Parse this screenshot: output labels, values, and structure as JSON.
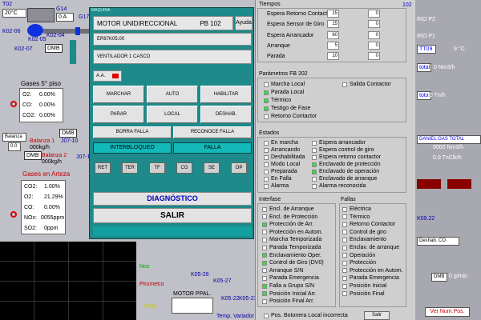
{
  "background": {
    "t02": "T02",
    "t02_val": "20°C",
    "g14": "G14",
    "g14_val": "0 A",
    "k02_06": "K02-06",
    "k02_05": "K02-05",
    "k02_04": "K02-04",
    "k02_07": "K02-07",
    "g17": "G17",
    "dmb": "DMB",
    "gases5": "Gases 5° piso",
    "o2_label": "O2:",
    "o2_val": "0.00%",
    "co_label": "CO:",
    "co_val": "0.00%",
    "co2_label": "CO2:",
    "co2_val": "0.00%",
    "balanza1": "Balanza 1",
    "balanza1_val": "000kg/h",
    "balanza2": "Balanza 2",
    "balanza2_val": "000kg/h",
    "balanza_label": "Balanza",
    "balanza_num": "0.0",
    "j07_10": "J07-10",
    "j07_11": "J07-11",
    "gases_arteza": "Gases en Arteza",
    "co2b_label": "CO2:",
    "co2b_val": "1.00%",
    "o2b_label": "O2:",
    "o2b_val": "21.29%",
    "cob_label": "CO:",
    "cob_val": "0.00%",
    "nox_label": "NOx:",
    "nox_val": "0055ppm",
    "so2_label": "SO2:",
    "so2_val": "0ppm",
    "nos": "Nos",
    "pirometro": "Pirometro",
    "rpm": "RPM",
    "k05_26": "K05-26",
    "k05_27": "K05-27",
    "k05_22": "K05-22",
    "k05_23": "K05-23",
    "motor": "MOTOR PPAL.",
    "temp_variador": "Temp. Variador"
  },
  "popup": {
    "window_title": "MAQUINA",
    "title": "MOTOR UNIDIRECCIONAL",
    "code": "PB 102",
    "help": "Ayuda",
    "field1": "ER67K05.00",
    "field2": "VENTILADOR 1 CASCO",
    "aa": "A.A.",
    "marchar": "MARCHAR",
    "auto": "AUTO",
    "habilitar": "HABILITAR",
    "parar": "PARAR",
    "local": "LOCAL",
    "deshab": "DESHAB.",
    "borra_falla": "BORRA FALLA",
    "reconoce_falla": "RECONOCE FALLA",
    "interbloqueo": "INTERBLOQUEO",
    "falla": "FALLA",
    "small_buttons": [
      "RET",
      "TER",
      "TF",
      "CG",
      "SE",
      "OP"
    ],
    "diagnostico": "DIAGNÓSTICO",
    "salir": "SALIR"
  },
  "right": {
    "tiempos": "Tiempos",
    "tiempo_rows": [
      {
        "label": "Espera Retorno Contactor",
        "v1": "15",
        "v2": "0"
      },
      {
        "label": "Espera Sensor de Giro",
        "v1": "15",
        "v2": "0"
      },
      {
        "label": "Espera Arrancador",
        "v1": "60",
        "v2": "0"
      },
      {
        "label": "Arranque",
        "v1": "5",
        "v2": "0"
      },
      {
        "label": "Parada",
        "v1": "10",
        "v2": "0"
      }
    ],
    "badge": "102",
    "parametros": "Parámetros FB 202",
    "param_left": [
      {
        "label": "Marcha Local",
        "on": false
      },
      {
        "label": "Parada Local",
        "on": true
      },
      {
        "label": "Térmico",
        "on": true
      },
      {
        "label": "Testigo de Fase",
        "on": true
      },
      {
        "label": "Retorno Contactor",
        "on": false
      }
    ],
    "param_right": [
      {
        "label": "Salida Contactor",
        "on": false
      }
    ],
    "estados": "Estados",
    "estados_left": [
      {
        "label": "En marcha",
        "on": false
      },
      {
        "label": "Arrancando",
        "on": false
      },
      {
        "label": "Deshabilitada",
        "on": false
      },
      {
        "label": "Modo Local",
        "on": false
      },
      {
        "label": "Preparada",
        "on": false
      },
      {
        "label": "En Falla",
        "on": false
      },
      {
        "label": "Alarma",
        "on": false
      }
    ],
    "estados_right": [
      {
        "label": "Espera arrancador",
        "on": false
      },
      {
        "label": "Espera control de giro",
        "on": false
      },
      {
        "label": "Espera retorno contactor",
        "on": false
      },
      {
        "label": "Enclavado de protección",
        "on": true
      },
      {
        "label": "Enclavado de operación",
        "on": true
      },
      {
        "label": "Enclavado de arranque",
        "on": false
      },
      {
        "label": "Alarma reconocida",
        "on": false
      }
    ],
    "interfase": "Interfase",
    "interfase_rows": [
      {
        "label": "Encl. de Arranque",
        "on": false
      },
      {
        "label": "Encl. de Protección",
        "on": false
      },
      {
        "label": "Protección de Arr.",
        "on": true
      },
      {
        "label": "Protección en Autom.",
        "on": false
      },
      {
        "label": "Marcha Temporizada",
        "on": false
      },
      {
        "label": "Parada Temporizada",
        "on": false
      },
      {
        "label": "Enclavamiento Oper.",
        "on": true
      },
      {
        "label": "Control de Giro (DV0)",
        "on": true
      },
      {
        "label": "Arranque S/N",
        "on": false
      },
      {
        "label": "Parada Emergencia",
        "on": false
      },
      {
        "label": "Falla a Grupo S/N",
        "on": true
      },
      {
        "label": "Posición Inicial Arr.",
        "on": true
      },
      {
        "label": "Posición Final Arr.",
        "on": false
      }
    ],
    "fallas": "Fallas",
    "fallas_rows": [
      {
        "label": "Eléctrica",
        "on": false
      },
      {
        "label": "Térmico",
        "on": false
      },
      {
        "label": "Retorno Contactor",
        "on": false
      },
      {
        "label": "Control de giro",
        "on": false
      },
      {
        "label": "Enclavamiento",
        "on": false
      },
      {
        "label": "Enclav. de arranque",
        "on": false
      },
      {
        "label": "Operación",
        "on": false
      },
      {
        "label": "Protección",
        "on": false
      },
      {
        "label": "Protección en Autom.",
        "on": false
      },
      {
        "label": "Parada Emergencia",
        "on": false
      },
      {
        "label": "Posición Inicial",
        "on": false
      },
      {
        "label": "Posición Final",
        "on": false
      }
    ],
    "pos_botonera": "Pos. Botonera Local incorrecta",
    "salir": "Salir"
  },
  "far": {
    "rio_p2": "RIO P2",
    "rio_p1": "RIO P1",
    "tt09": "TT09",
    "tt09_val": "9 °C.",
    "total": "total",
    "total_val": "0 Nm3/h",
    "total2": "total",
    "total2_val": "00 Tn/h",
    "daniel": "DANIEL GAS TOTAL",
    "daniel_val1": "0000 Nm3/h",
    "daniel_val2": "0.0 TnClk/h",
    "k09": "K09.22",
    "dmb": "DMB",
    "deshab_co": "Deshab. CO",
    "gmin": "0 g/min",
    "ver": "Ver Num.Pos."
  },
  "colors": {
    "popup_bg": "#1e8a8a",
    "band": "#13b8b8",
    "led_on": "#2ee62e",
    "alarm": "#e00000"
  }
}
